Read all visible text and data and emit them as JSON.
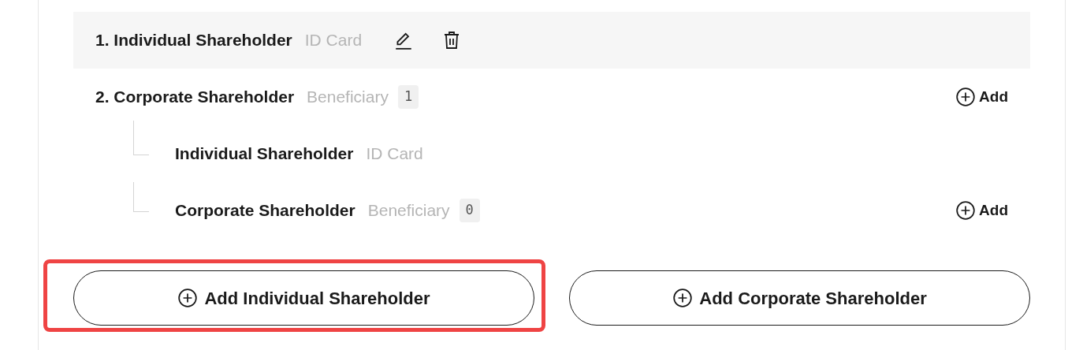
{
  "shareholders": [
    {
      "number": "1.",
      "name": "Individual Shareholder",
      "doc": "ID Card",
      "kind": "individual",
      "selected": true
    },
    {
      "number": "2.",
      "name": "Corporate Shareholder",
      "doc": "Beneficiary",
      "count": "1",
      "kind": "corporate",
      "add_label": "Add",
      "selected": false,
      "children": [
        {
          "name": "Individual Shareholder",
          "doc": "ID Card",
          "kind": "individual"
        },
        {
          "name": "Corporate Shareholder",
          "doc": "Beneficiary",
          "count": "0",
          "kind": "corporate",
          "add_label": "Add"
        }
      ]
    }
  ],
  "buttons": [
    {
      "label": "Add Individual Shareholder",
      "highlighted": true
    },
    {
      "label": "Add Corporate Shareholder",
      "highlighted": false
    }
  ]
}
